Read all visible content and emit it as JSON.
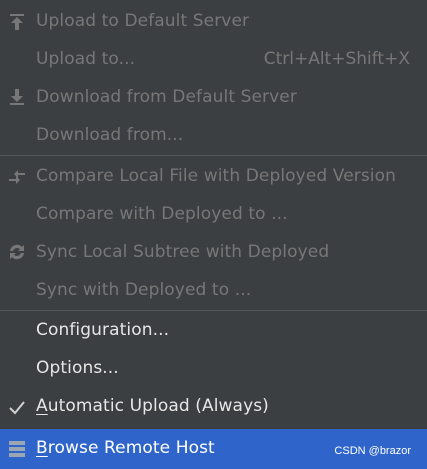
{
  "menu": {
    "items": [
      {
        "label": "Upload to Default Server",
        "shortcut": "",
        "enabled": false,
        "icon": "upload-icon"
      },
      {
        "label": "Upload to...",
        "shortcut": "Ctrl+Alt+Shift+X",
        "enabled": false,
        "icon": ""
      },
      {
        "label": "Download from Default Server",
        "shortcut": "",
        "enabled": false,
        "icon": "download-icon"
      },
      {
        "label": "Download from...",
        "shortcut": "",
        "enabled": false,
        "icon": ""
      },
      {
        "label": "Compare Local File with Deployed Version",
        "shortcut": "",
        "enabled": false,
        "icon": "compare-icon"
      },
      {
        "label": "Compare with Deployed to ...",
        "shortcut": "",
        "enabled": false,
        "icon": ""
      },
      {
        "label": "Sync Local Subtree with Deployed",
        "shortcut": "",
        "enabled": false,
        "icon": "sync-icon"
      },
      {
        "label": "Sync with Deployed to ...",
        "shortcut": "",
        "enabled": false,
        "icon": ""
      },
      {
        "label": "Configuration...",
        "shortcut": "",
        "enabled": true,
        "icon": ""
      },
      {
        "label": "Options...",
        "shortcut": "",
        "enabled": true,
        "icon": ""
      },
      {
        "label_mnemonic": "A",
        "label_rest": "utomatic Upload (Always)",
        "checked": true,
        "enabled": true,
        "icon": "checkmark-icon"
      },
      {
        "label_mnemonic": "B",
        "label_rest": "rowse Remote Host",
        "enabled": true,
        "selected": true,
        "icon": "server-icon"
      }
    ]
  },
  "watermark": "CSDN @brazor",
  "colors": {
    "background": "#3c3f41",
    "disabled_text": "#777777",
    "enabled_text": "#e6e6e6",
    "selected_background": "#2f65ca",
    "separator": "#545658"
  }
}
